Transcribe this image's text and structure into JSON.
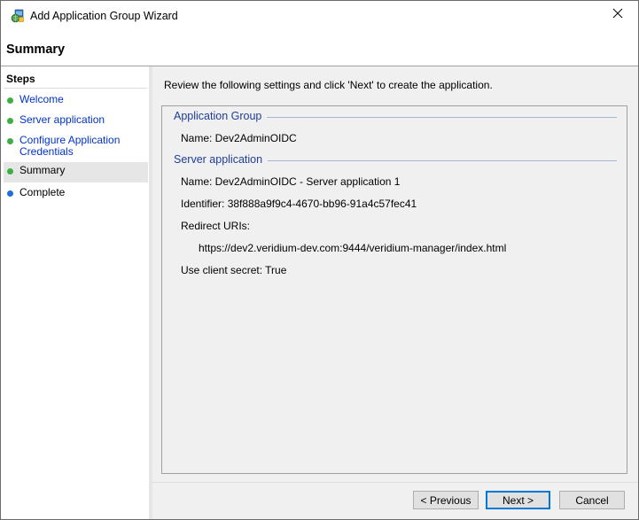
{
  "window": {
    "title": "Add Application Group Wizard",
    "icon": "app-group-wizard-icon",
    "close_icon": "close-icon"
  },
  "header": {
    "page_title": "Summary"
  },
  "steps": {
    "title": "Steps",
    "items": [
      {
        "label": "Welcome",
        "state": "done"
      },
      {
        "label": "Server application",
        "state": "done"
      },
      {
        "label": "Configure Application Credentials",
        "state": "done"
      },
      {
        "label": "Summary",
        "state": "current"
      },
      {
        "label": "Complete",
        "state": "pending"
      }
    ]
  },
  "main": {
    "instructions": "Review the following settings and click 'Next' to create the application.",
    "application_group": {
      "title": "Application Group",
      "name": "Name: Dev2AdminOIDC"
    },
    "server_application": {
      "title": "Server application",
      "name": "Name: Dev2AdminOIDC - Server application 1",
      "identifier": "Identifier: 38f888a9f9c4-4670-bb96-91a4c57fec41",
      "redirect_uris_label": "Redirect URIs:",
      "redirect_uri": "https://dev2.veridium-dev.com:9444/veridium-manager/index.html",
      "client_secret": "Use client secret: True"
    }
  },
  "buttons": {
    "previous": "< Previous",
    "next": "Next >",
    "cancel": "Cancel"
  },
  "colors": {
    "step_done": "#3cb043",
    "step_current": "#3cb043",
    "step_pending": "#1e6fd9",
    "link": "#0033cc",
    "section_title": "#1f3d99"
  }
}
